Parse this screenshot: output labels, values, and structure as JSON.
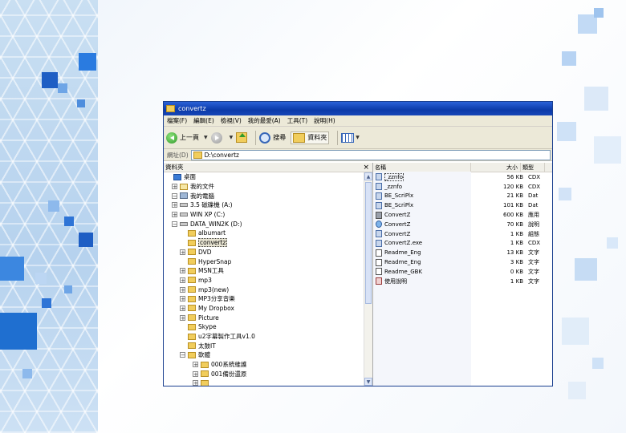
{
  "window": {
    "title": "convertz",
    "menu": [
      "檔案(F)",
      "編輯(E)",
      "檢視(V)",
      "我的最愛(A)",
      "工具(T)",
      "說明(H)"
    ],
    "toolbar": {
      "back_label": "上一頁",
      "search_label": "搜尋",
      "folders_label": "資料夾"
    },
    "address": {
      "label": "網址(D)",
      "value": "D:\\convertz"
    }
  },
  "tree": {
    "header": "資料夾",
    "close_glyph": "×",
    "nodes": [
      {
        "label": "桌面",
        "toggle": "",
        "indent": 0,
        "icon": "desk"
      },
      {
        "label": "我的文件",
        "toggle": "+",
        "indent": 1,
        "icon": "docs"
      },
      {
        "label": "我的電腦",
        "toggle": "−",
        "indent": 1,
        "icon": "pc"
      },
      {
        "label": "3.5 磁碟機 (A:)",
        "toggle": "+",
        "indent": 2,
        "icon": "drive"
      },
      {
        "label": "WIN XP (C:)",
        "toggle": "+",
        "indent": 2,
        "icon": "drive"
      },
      {
        "label": "DATA_WIN2K (D:)",
        "toggle": "−",
        "indent": 2,
        "icon": "drive"
      },
      {
        "label": "albumart",
        "toggle": "",
        "indent": 3,
        "icon": "folder"
      },
      {
        "label": "convertz",
        "toggle": "",
        "indent": 3,
        "icon": "folder",
        "selected": true
      },
      {
        "label": "DVD",
        "toggle": "+",
        "indent": 3,
        "icon": "folder"
      },
      {
        "label": "HyperSnap",
        "toggle": "",
        "indent": 3,
        "icon": "folder"
      },
      {
        "label": "MSN工具",
        "toggle": "+",
        "indent": 3,
        "icon": "folder"
      },
      {
        "label": "mp3",
        "toggle": "+",
        "indent": 3,
        "icon": "folder"
      },
      {
        "label": "mp3(new)",
        "toggle": "+",
        "indent": 3,
        "icon": "folder"
      },
      {
        "label": "MP3分享音樂",
        "toggle": "+",
        "indent": 3,
        "icon": "folder"
      },
      {
        "label": "My Dropbox",
        "toggle": "+",
        "indent": 3,
        "icon": "folder"
      },
      {
        "label": "Picture",
        "toggle": "+",
        "indent": 3,
        "icon": "pix"
      },
      {
        "label": "Skype",
        "toggle": "",
        "indent": 3,
        "icon": "folder"
      },
      {
        "label": "u2字幕製作工具v1.0",
        "toggle": "",
        "indent": 3,
        "icon": "folder"
      },
      {
        "label": "太鼓IT",
        "toggle": "",
        "indent": 3,
        "icon": "folder"
      },
      {
        "label": "軟體",
        "toggle": "−",
        "indent": 3,
        "icon": "folder"
      },
      {
        "label": "000系統維護",
        "toggle": "+",
        "indent": 4,
        "icon": "folder"
      },
      {
        "label": "001備份還原",
        "toggle": "+",
        "indent": 4,
        "icon": "folder"
      },
      {
        "label": "",
        "toggle": "+",
        "indent": 4,
        "icon": "folder"
      }
    ]
  },
  "list": {
    "columns": {
      "name": "名稱",
      "size": "大小",
      "type": "類型"
    },
    "rows": [
      {
        "name": "_zznfo",
        "size": "56 KB",
        "type": "CDX",
        "icon": "app"
      },
      {
        "name": "_zznfo",
        "size": "120 KB",
        "type": "CDX",
        "icon": "app"
      },
      {
        "name": "BE_ScriPlx",
        "size": "21 KB",
        "type": "Dat",
        "icon": "app"
      },
      {
        "name": "BE_ScriPlx",
        "size": "101 KB",
        "type": "Dat",
        "icon": "app"
      },
      {
        "name": "ConvertZ",
        "size": "600 KB",
        "type": "應用",
        "icon": "gear"
      },
      {
        "name": "ConvertZ",
        "size": "70 KB",
        "type": "說明",
        "icon": "ie"
      },
      {
        "name": "ConvertZ",
        "size": "1 KB",
        "type": "組態",
        "icon": "app"
      },
      {
        "name": "ConvertZ.exe",
        "size": "1 KB",
        "type": "CDX",
        "icon": "app"
      },
      {
        "name": "Readme_Eng",
        "size": "13 KB",
        "type": "文字",
        "icon": "txt"
      },
      {
        "name": "Readme_Eng",
        "size": "3 KB",
        "type": "文字",
        "icon": "txt"
      },
      {
        "name": "Readme_GBK",
        "size": "0 KB",
        "type": "文字",
        "icon": "txt"
      },
      {
        "name": "使用說明",
        "size": "1 KB",
        "type": "文字",
        "icon": "red"
      }
    ]
  },
  "colors": {
    "title_bar": "#0b3aa8",
    "chrome": "#ece9d8",
    "background_squares": "#1f6fd0"
  }
}
